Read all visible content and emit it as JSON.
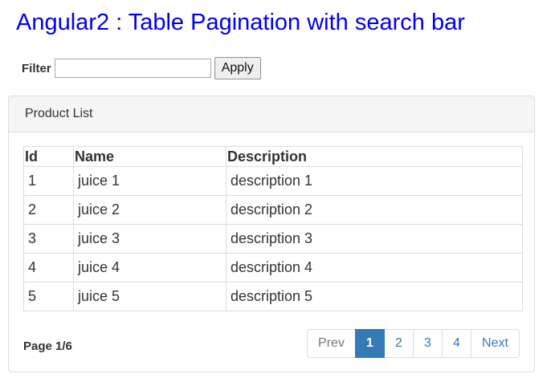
{
  "page": {
    "title": "Angular2 : Table Pagination with search bar"
  },
  "filter": {
    "label": "Filter",
    "value": "",
    "apply_label": "Apply"
  },
  "panel": {
    "heading": "Product List"
  },
  "table": {
    "headers": [
      "Id",
      "Name",
      "Description"
    ],
    "rows": [
      [
        "1",
        "juice 1",
        "description 1"
      ],
      [
        "2",
        "juice 2",
        "description 2"
      ],
      [
        "3",
        "juice 3",
        "description 3"
      ],
      [
        "4",
        "juice 4",
        "description 4"
      ],
      [
        "5",
        "juice 5",
        "description 5"
      ]
    ]
  },
  "pagination": {
    "info": "Page 1/6",
    "prev_label": "Prev",
    "next_label": "Next",
    "pages": [
      "1",
      "2",
      "3",
      "4"
    ],
    "active_page": "1"
  },
  "colors": {
    "title": "#0000ee",
    "link": "#337ab7",
    "active": "#337ab7"
  }
}
